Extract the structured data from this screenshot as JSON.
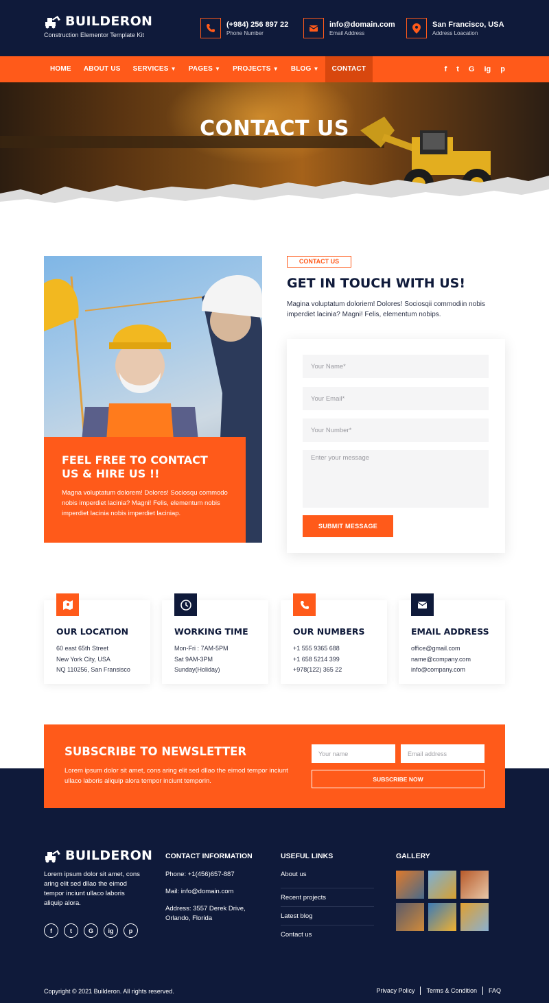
{
  "brand": {
    "name": "BUILDERON",
    "tagline": "Construction Elementor Template Kit"
  },
  "topbar": {
    "phone": {
      "title": "(+984) 256 897 22",
      "sub": "Phone Number"
    },
    "email": {
      "title": "info@domain.com",
      "sub": "Email Address"
    },
    "address": {
      "title": "San Francisco, USA",
      "sub": "Address Loacation"
    }
  },
  "nav": {
    "items": [
      "HOME",
      "ABOUT US",
      "SERVICES",
      "PAGES",
      "PROJECTS",
      "BLOG",
      "CONTACT"
    ],
    "social": [
      "f",
      "t",
      "G",
      "ig",
      "p"
    ]
  },
  "hero": {
    "title": "CONTACT US"
  },
  "contact": {
    "badge": "CONTACT US",
    "title": "GET IN TOUCH WITH US!",
    "description": "Magina voluptatum doloriem! Dolores! Sociosqii commodiin nobis imperdiet lacinia? Magni! Felis, elementum nobips.",
    "photo_box": {
      "title": "FEEL FREE TO CONTACT US & HIRE US !!",
      "text": "Magna voluptatum dolorem! Dolores! Sociosqu commodo nobis imperdiet lacinia? Magni! Felis, elementum nobis imperdiet lacinia nobis imperdiet laciniap."
    },
    "form": {
      "name_placeholder": "Your Name*",
      "email_placeholder": "Your Email*",
      "number_placeholder": "Your Number*",
      "message_placeholder": "Enter your message",
      "submit_label": "SUBMIT MESSAGE"
    }
  },
  "info_cards": [
    {
      "title": "OUR LOCATION",
      "lines": [
        "60 east 65th Street",
        "New York City, USA",
        "NQ 110256, San Fransisco"
      ],
      "icon": "map-icon",
      "icon_color": "#ff5a1a"
    },
    {
      "title": "WORKING TIME",
      "lines": [
        "Mon-Fri : 7AM-5PM",
        "Sat 9AM-3PM",
        "Sunday(Holiday)"
      ],
      "icon": "clock-icon",
      "icon_color": "#0f1a3a"
    },
    {
      "title": "OUR NUMBERS",
      "lines": [
        "+1 555 9365 688",
        "+1 658 5214 399",
        "+978(122) 365 22"
      ],
      "icon": "phone-icon",
      "icon_color": "#ff5a1a"
    },
    {
      "title": "EMAIL ADDRESS",
      "lines": [
        "office@gmail.com",
        "name@company.com",
        "info@company.com"
      ],
      "icon": "mail-icon",
      "icon_color": "#0f1a3a"
    }
  ],
  "newsletter": {
    "title": "SUBSCRIBE TO NEWSLETTER",
    "description": "Lorem ipsum dolor sit amet, cons aring elit sed dllao the eimod tempor inciunt ullaco laboris aliquip alora tempor inciunt temporin.",
    "name_placeholder": "Your name",
    "email_placeholder": "Email address",
    "button_label": "SUBSCRIBE NOW"
  },
  "footer": {
    "about": "Lorem ipsum dolor sit amet, cons aring elit sed dllao the eimod tempor inciunt ullaco laboris aliquip alora.",
    "social": [
      "f",
      "t",
      "G",
      "ig",
      "p"
    ],
    "contact_title": "CONTACT INFORMATION",
    "contact_lines": [
      "Phone: +1(456)657-887",
      "Mail: info@domain.com",
      "Address: 3557 Derek Drive, Orlando, Florida"
    ],
    "links_title": "USEFUL LINKS",
    "links": [
      "About us",
      "Recent projects",
      "Latest blog",
      "Contact us"
    ],
    "gallery_title": "GALLERY",
    "copyright": "Copyright © 2021 Builderon. All rights reserved.",
    "bottom_links": [
      "Privacy Policy",
      "Terms & Condition",
      "FAQ"
    ]
  },
  "colors": {
    "accent": "#ff5a1a",
    "navy": "#0f1a3a"
  }
}
